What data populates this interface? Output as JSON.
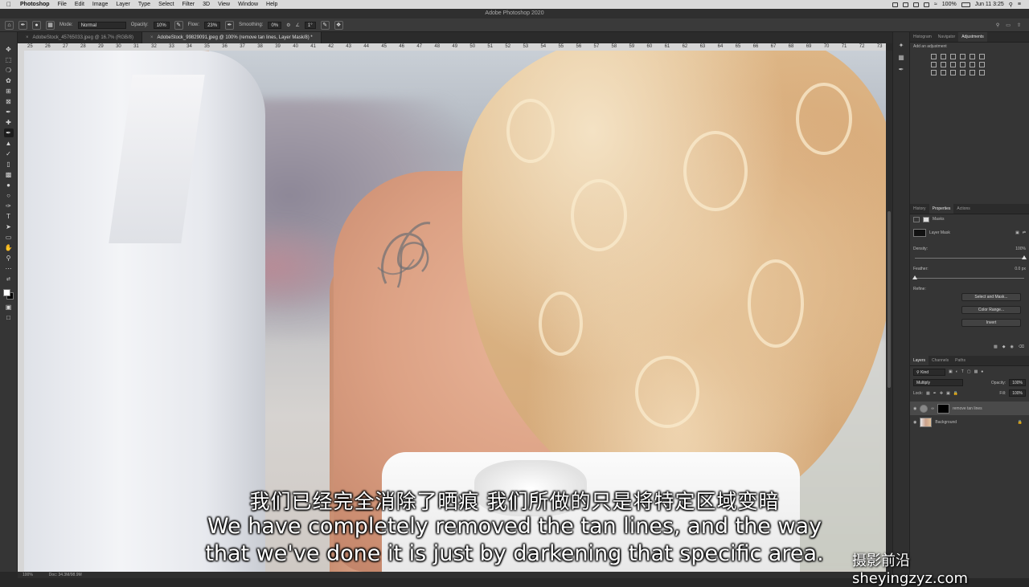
{
  "menubar": {
    "apple": "",
    "app": "Photoshop",
    "items": [
      "File",
      "Edit",
      "Image",
      "Layer",
      "Type",
      "Select",
      "Filter",
      "3D",
      "View",
      "Window",
      "Help"
    ],
    "battery": "100%",
    "clock": "Jun 11  3:25"
  },
  "window_title": "Adobe Photoshop 2020",
  "options": {
    "mode_label": "Mode:",
    "mode_value": "Normal",
    "opacity_label": "Opacity:",
    "opacity_value": "10%",
    "flow_label": "Flow:",
    "flow_value": "23%",
    "smoothing_label": "Smoothing:",
    "smoothing_value": "0%",
    "angle_value": "1°"
  },
  "tabs": [
    {
      "label": "AdobeStock_45765033.jpeg @ 16.7% (RGB/8)"
    },
    {
      "label": "AdobeStock_99829091.jpeg @ 100% (remove tan lines, Layer Mask/8) *"
    }
  ],
  "ruler_ticks": [
    "25",
    "26",
    "27",
    "28",
    "29",
    "30",
    "31",
    "32",
    "33",
    "34",
    "35",
    "36",
    "37",
    "38",
    "39",
    "40",
    "41",
    "42",
    "43",
    "44",
    "45",
    "46",
    "47",
    "48",
    "49",
    "50",
    "51",
    "52",
    "53",
    "54",
    "55",
    "56",
    "57",
    "58",
    "59",
    "60",
    "61",
    "62",
    "63",
    "64",
    "65",
    "66",
    "67",
    "68",
    "69",
    "70",
    "71",
    "72",
    "73"
  ],
  "subtitles": {
    "cn": "我们已经完全消除了晒痕 我们所做的只是将特定区域变暗",
    "en_line1": "We have completely removed the tan lines, and the way",
    "en_line2": "that we've done it is just by darkening that specific area."
  },
  "watermark": "摄影前沿 sheyingzyz.com",
  "status": {
    "zoom": "100%",
    "doc": "Doc: 34.3M/98.9M"
  },
  "panels": {
    "top_tabs": [
      "Histogram",
      "Navigator",
      "Adjustments"
    ],
    "add_adjustment": "Add an adjustment",
    "mid_tabs": [
      "History",
      "Properties",
      "Actions"
    ],
    "masks_label": "Masks",
    "layer_mask_label": "Layer Mask",
    "density_label": "Density:",
    "density_value": "100%",
    "feather_label": "Feather:",
    "feather_value": "0.0 px",
    "refine_label": "Refine:",
    "select_mask_btn": "Select and Mask...",
    "color_range_btn": "Color Range...",
    "invert_btn": "Invert",
    "layer_tabs": [
      "Layers",
      "Channels",
      "Paths"
    ],
    "kind_label": "Kind",
    "blend_mode": "Multiply",
    "opacity_label": "Opacity:",
    "opacity_value": "100%",
    "lock_label": "Lock:",
    "fill_label": "Fill:",
    "fill_value": "100%",
    "layers": [
      {
        "name": "remove tan lines"
      },
      {
        "name": "Background"
      }
    ]
  }
}
